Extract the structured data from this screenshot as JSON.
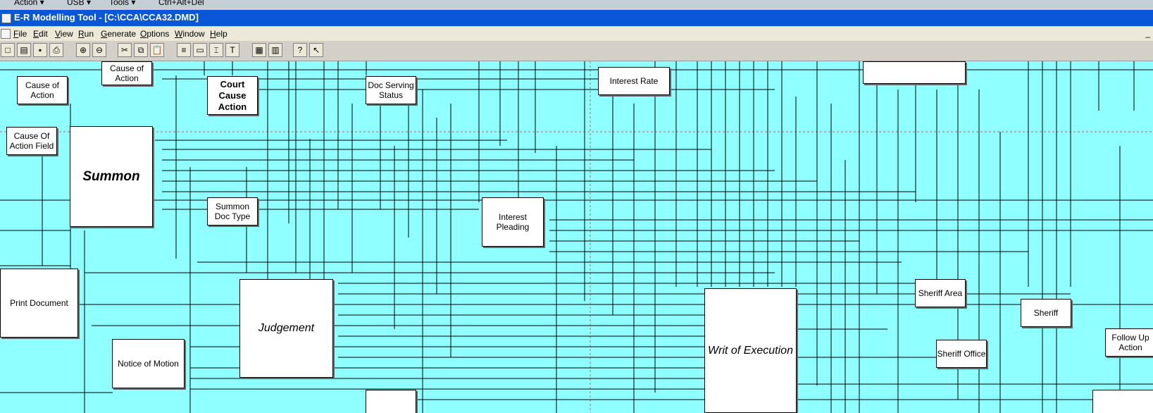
{
  "top_strip": [
    "Action ▾",
    "USB ▾",
    "Tools ▾",
    "Ctrl+Alt+Del"
  ],
  "window": {
    "title": "E-R Modelling Tool - [C:\\CCA\\CCA32.DMD]"
  },
  "menu": [
    "File",
    "Edit",
    "View",
    "Run",
    "Generate",
    "Options",
    "Window",
    "Help"
  ],
  "toolbar": [
    "□",
    "▤",
    "▪",
    "⎙",
    "⊕",
    "⊖",
    "✂",
    "⧉",
    "📋",
    "≡",
    "▭",
    "⌶",
    "T",
    "▦",
    "▥",
    "?",
    "↖"
  ],
  "entities": {
    "cause_of_action_top": "Cause of\nAction",
    "cause_of_action": "Cause of\nAction",
    "court_cause_action": "Court\nCause\nAction",
    "doc_serving_status": "Doc Serving\nStatus",
    "interest_rate": "Interest Rate",
    "cause_of_action_field": "Cause Of\nAction Field",
    "summon": "Summon",
    "summon_doc_type": "Summon\nDoc Type",
    "interest_pleading": "Interest\nPleading",
    "print_document": "Print Document",
    "judgement": "Judgement",
    "notice_of_motion": "Notice of Motion",
    "writ_of_execution": "Writ of Execution",
    "sheriff_area": "Sheriff Area",
    "sheriff": "Sheriff",
    "sheriff_office": "Sheriff Office",
    "follow_up_action": "Follow Up\nAction"
  }
}
